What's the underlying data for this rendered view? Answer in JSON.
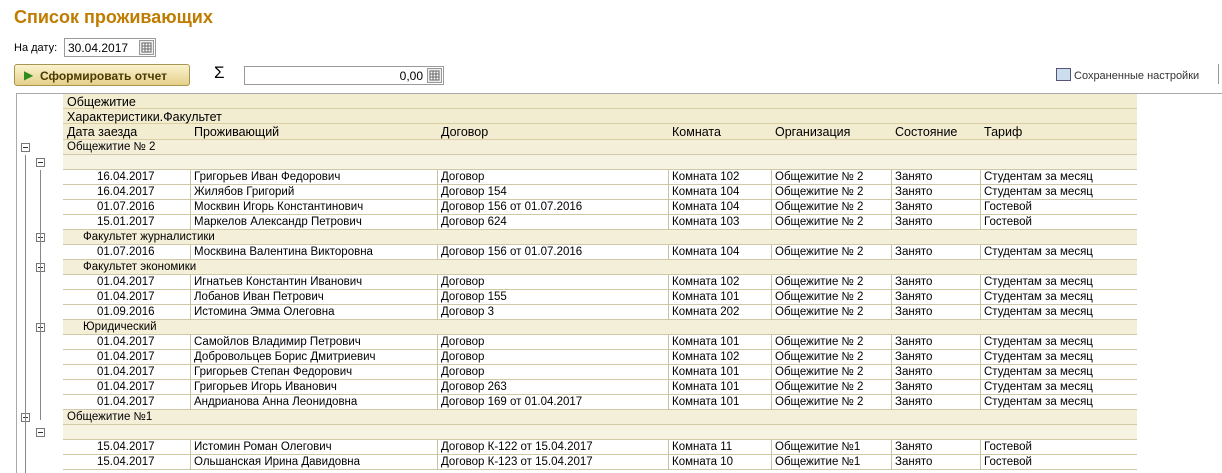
{
  "title": "Список проживающих",
  "date_label": "На дату:",
  "date_value": "30.04.2017",
  "run_button": "Сформировать отчет",
  "sigma": "Σ",
  "sum_value": "0,00",
  "saved_settings": "Сохраненные настройки",
  "header": {
    "group1": "Общежитие",
    "group2": "Характеристики.Факультет",
    "columns": [
      "Дата заезда",
      "Проживающий",
      "Договор",
      "Комната",
      "Организация",
      "Состояние",
      "Тариф"
    ]
  },
  "rows": [
    {
      "kind": "grp",
      "level": 0,
      "text": "Общежитие № 2"
    },
    {
      "kind": "blank",
      "level": 1,
      "text": ""
    },
    {
      "kind": "data",
      "cells": [
        "16.04.2017",
        "Григорьев Иван Федорович",
        "Договор",
        "Комната 102",
        "Общежитие № 2",
        "Занято",
        "Студентам за месяц"
      ]
    },
    {
      "kind": "data",
      "cells": [
        "16.04.2017",
        "Жилябов Григорий",
        "Договор 154",
        "Комната 104",
        "Общежитие № 2",
        "Занято",
        "Студентам за месяц"
      ]
    },
    {
      "kind": "data",
      "cells": [
        "01.07.2016",
        "Москвин Игорь Константинович",
        "Договор 156 от 01.07.2016",
        "Комната 104",
        "Общежитие № 2",
        "Занято",
        "Гостевой"
      ]
    },
    {
      "kind": "data",
      "cells": [
        "15.01.2017",
        "Маркелов Александр Петрович",
        "Договор 624",
        "Комната 103",
        "Общежитие № 2",
        "Занято",
        "Гостевой"
      ]
    },
    {
      "kind": "grp",
      "level": 1,
      "text": "Факультет журналистики"
    },
    {
      "kind": "data",
      "cells": [
        "01.07.2016",
        "Москвина Валентина Викторовна",
        "Договор 156 от 01.07.2016",
        "Комната 104",
        "Общежитие № 2",
        "Занято",
        "Студентам за месяц"
      ]
    },
    {
      "kind": "grp",
      "level": 1,
      "text": "Факультет экономики"
    },
    {
      "kind": "data",
      "cells": [
        "01.04.2017",
        "Игнатьев Константин Иванович",
        "Договор",
        "Комната 102",
        "Общежитие № 2",
        "Занято",
        "Студентам за месяц"
      ]
    },
    {
      "kind": "data",
      "cells": [
        "01.04.2017",
        "Лобанов Иван Петрович",
        "Договор 155",
        "Комната 101",
        "Общежитие № 2",
        "Занято",
        "Студентам за месяц"
      ]
    },
    {
      "kind": "data",
      "cells": [
        "01.09.2016",
        "Истомина Эмма Олеговна",
        "Договор 3",
        "Комната 202",
        "Общежитие № 2",
        "Занято",
        "Студентам за месяц"
      ]
    },
    {
      "kind": "grp",
      "level": 1,
      "text": "Юридический"
    },
    {
      "kind": "data",
      "cells": [
        "01.04.2017",
        "Самойлов Владимир Петрович",
        "Договор",
        "Комната 101",
        "Общежитие № 2",
        "Занято",
        "Студентам за месяц"
      ]
    },
    {
      "kind": "data",
      "cells": [
        "01.04.2017",
        "Добровольцев Борис Дмитриевич",
        "Договор",
        "Комната 102",
        "Общежитие № 2",
        "Занято",
        "Студентам за месяц"
      ]
    },
    {
      "kind": "data",
      "cells": [
        "01.04.2017",
        "Григорьев Степан Федорович",
        "Договор",
        "Комната 101",
        "Общежитие № 2",
        "Занято",
        "Студентам за месяц"
      ]
    },
    {
      "kind": "data",
      "cells": [
        "01.04.2017",
        "Григорьев Игорь Иванович",
        "Договор 263",
        "Комната 101",
        "Общежитие № 2",
        "Занято",
        "Студентам за месяц"
      ]
    },
    {
      "kind": "data",
      "cells": [
        "01.04.2017",
        "Андрианова Анна Леонидовна",
        "Договор 169 от 01.04.2017",
        "Комната 101",
        "Общежитие № 2",
        "Занято",
        "Студентам за месяц"
      ]
    },
    {
      "kind": "grp",
      "level": 0,
      "text": "Общежитие №1"
    },
    {
      "kind": "blank",
      "level": 1,
      "text": ""
    },
    {
      "kind": "data",
      "cells": [
        "15.04.2017",
        "Истомин Роман Олегович",
        "Договор К-122 от 15.04.2017",
        "Комната 11",
        "Общежитие №1",
        "Занято",
        "Гостевой"
      ]
    },
    {
      "kind": "data",
      "cells": [
        "15.04.2017",
        "Ольшанская Ирина Давидовна",
        "Договор К-123 от 15.04.2017",
        "Комната 10",
        "Общежитие №1",
        "Занято",
        "Гостевой"
      ]
    }
  ]
}
